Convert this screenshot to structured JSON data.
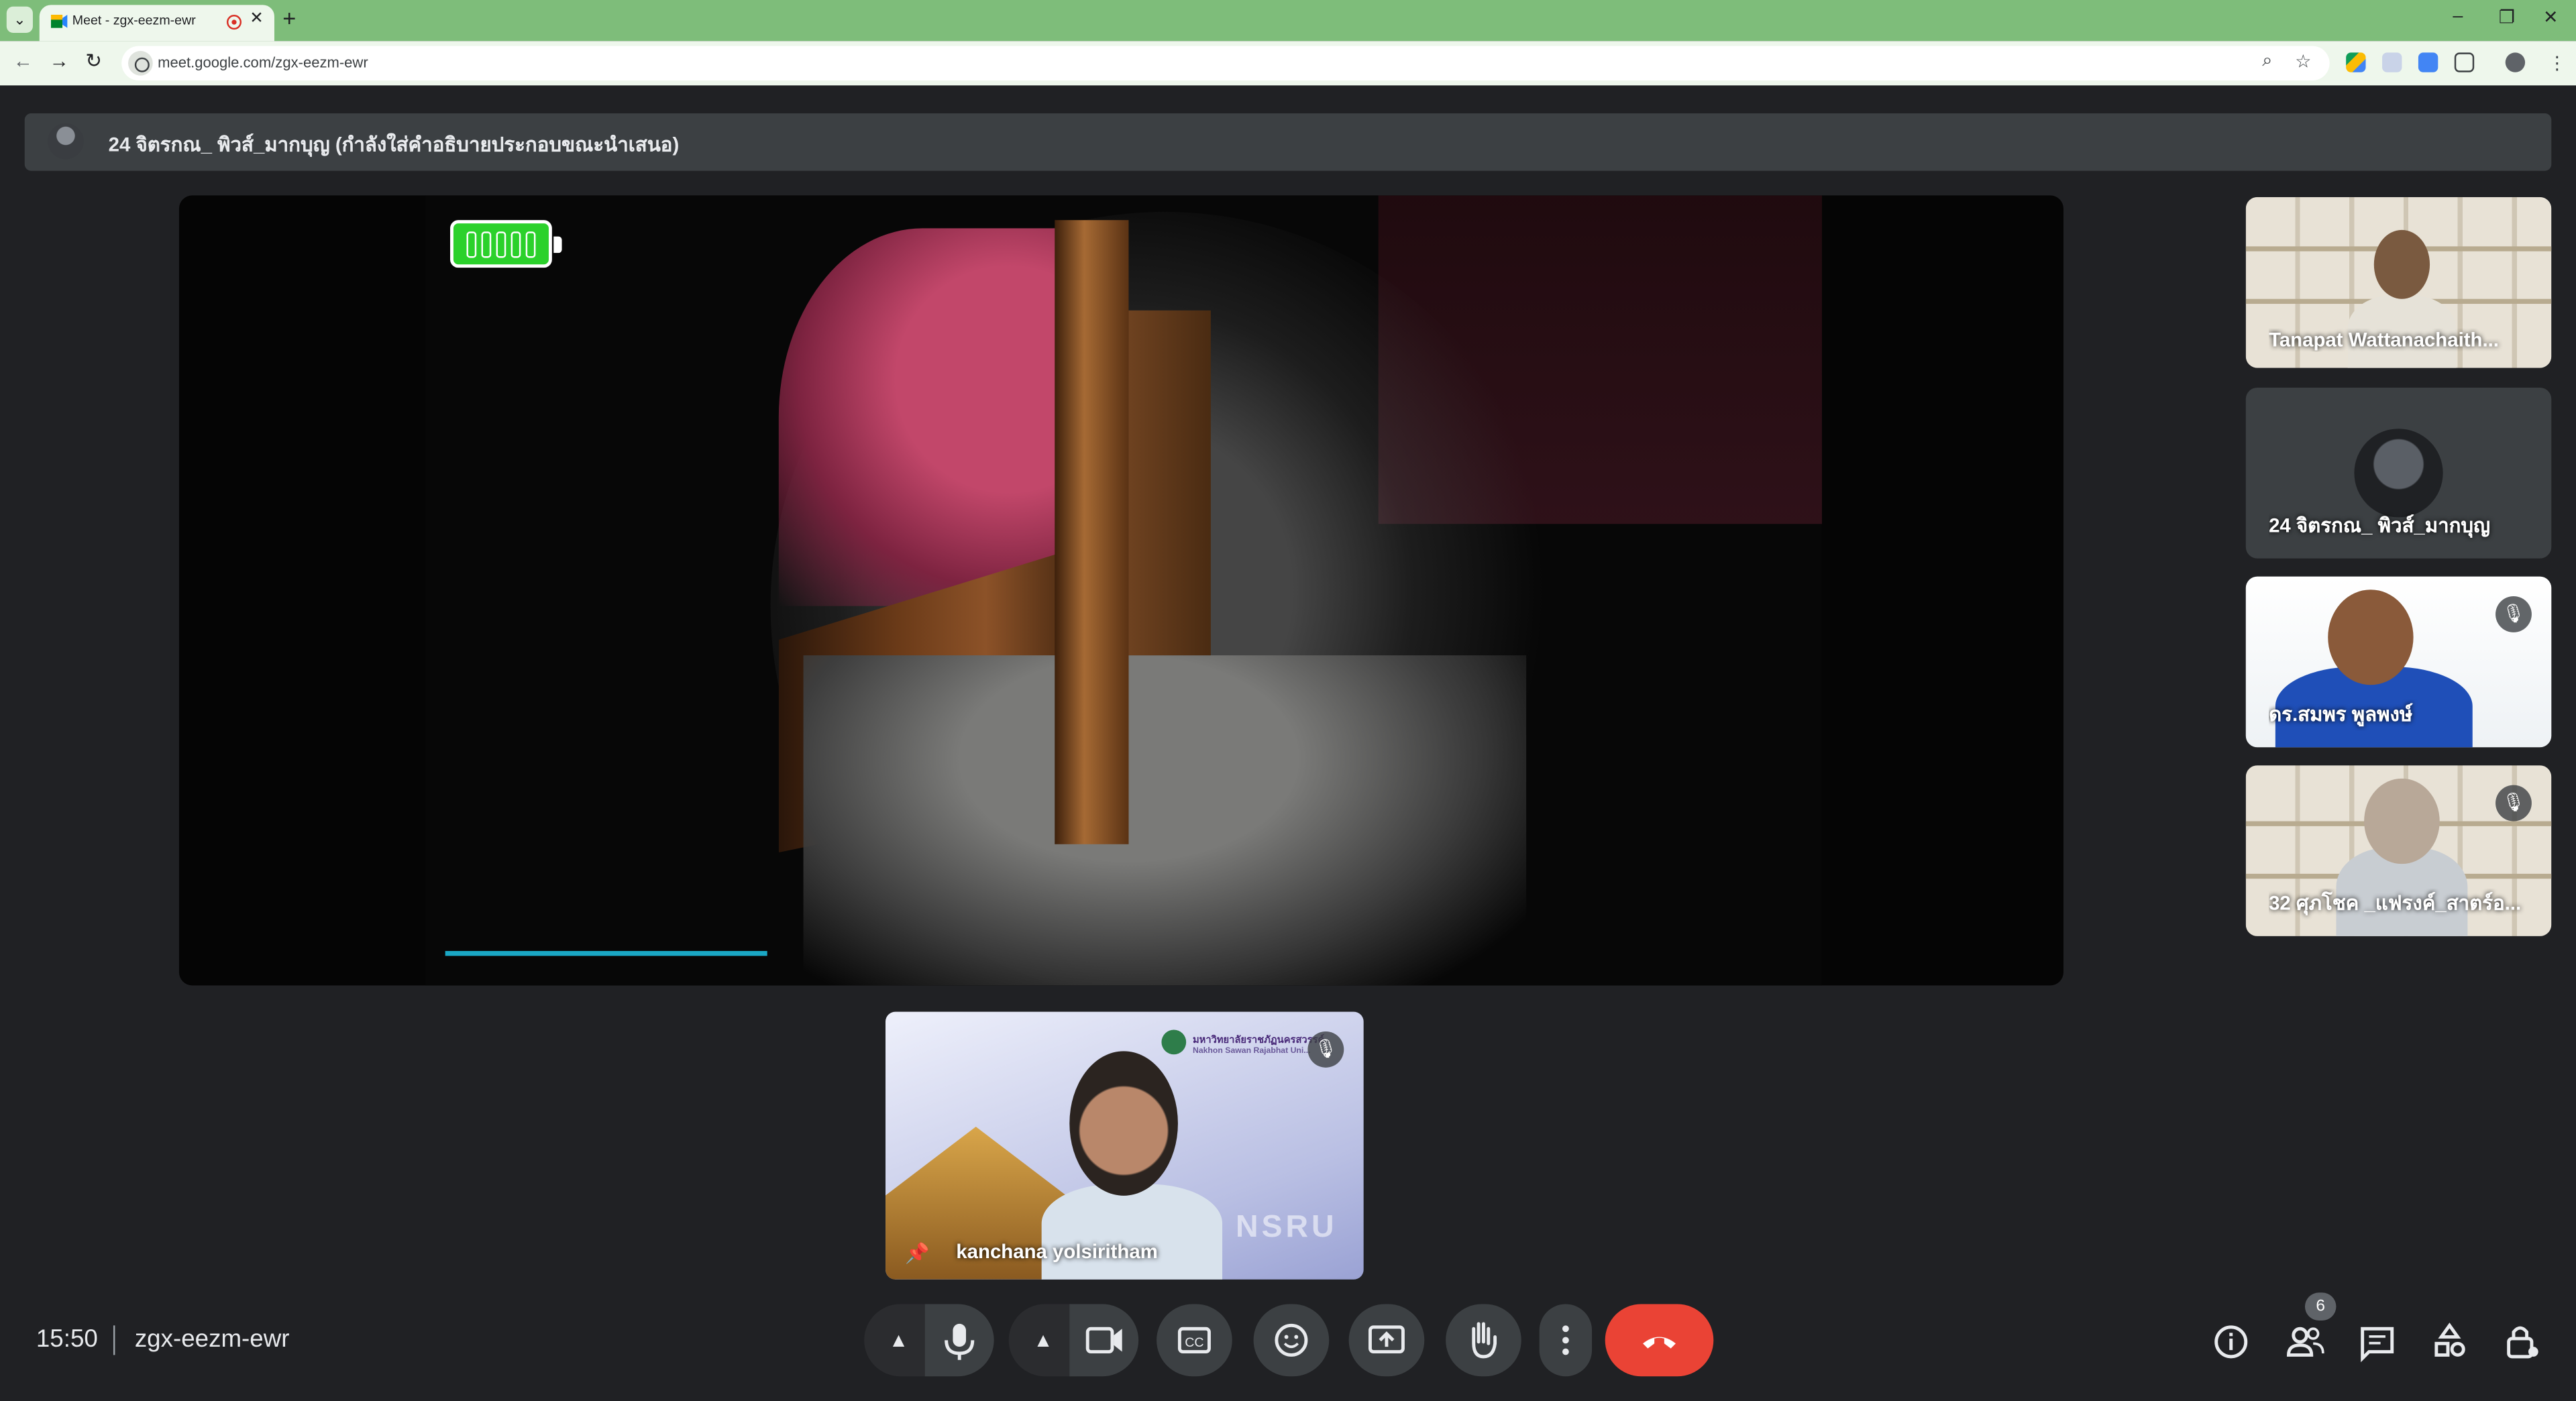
{
  "browser": {
    "tab_title": "Meet - zgx-eezm-ewr",
    "tab_close": "✕",
    "new_tab": "+",
    "url": "meet.google.com/zgx-eezm-ewr",
    "window_controls": [
      "–",
      "❐",
      "✕"
    ],
    "nav": [
      "←",
      "→",
      "↻"
    ]
  },
  "presenter_banner": {
    "text": "24 จิตรกณ_ พิวส์_มากบุญ (กำลังใส่คำอธิบายประกอบขณะนำเสนอ)"
  },
  "participants": [
    {
      "name": "Tanapat Wattanachaith...",
      "muted": false
    },
    {
      "name": "24 จิตรกณ_ พิวส์_มากบุญ",
      "muted": false
    },
    {
      "name": "ดร.สมพร พูลพงษ์",
      "muted": true
    },
    {
      "name": "32 ศุภโชค _แฟรงค์_สาตร์อ...",
      "muted": true
    }
  ],
  "self_view": {
    "name": "kanchana yolsiritham",
    "logo_text": "มหาวิทยาลัยราชภัฏนครสวรรค์",
    "logo_subtext": "Nakhon Sawan Rajabhat Uni...",
    "watermark": "NSRU"
  },
  "meeting": {
    "time": "15:50",
    "code": "zgx-eezm-ewr",
    "people_count": "6"
  },
  "colors": {
    "tab_bar": "#7ebd7a",
    "hangup": "#ea4335",
    "loading_bar": "#1aa7c4",
    "battery": "#2bd12b"
  }
}
